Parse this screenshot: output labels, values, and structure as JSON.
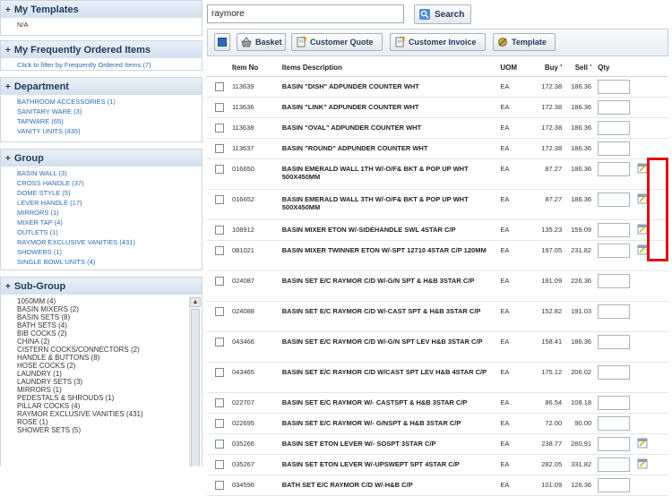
{
  "sidebar": {
    "templates": {
      "title": "My Templates",
      "value": "N/A"
    },
    "frequent": {
      "title": "My Frequently Ordered Items",
      "hint": "Click to filter by Frequently Ordered Items (7)"
    },
    "department": {
      "title": "Department",
      "items": [
        "BATHROOM ACCESSORIES (1)",
        "SANITARY WARE (3)",
        "TAPWARE (65)",
        "VANITY UNITS (435)"
      ]
    },
    "group": {
      "title": "Group",
      "items": [
        "BASIN WALL (3)",
        "CROSS HANDLE (37)",
        "DOME STYLE (5)",
        "LEVER HANDLE (17)",
        "MIRRORS (1)",
        "MIXER TAP (4)",
        "OUTLETS (1)",
        "RAYMOR EXCLUSIVE VANITIES (431)",
        "SHOWERS (1)",
        "SINGLE BOWL UNITS (4)"
      ]
    },
    "subgroup": {
      "title": "Sub-Group",
      "items": [
        "1050MM (4)",
        "BASIN MIXERS (2)",
        "BASIN SETS (8)",
        "BATH SETS (4)",
        "BIB COCKS (2)",
        "CHINA (2)",
        "CISTERN COCKS/CONNECTORS (2)",
        "HANDLE & BUTTONS (8)",
        "HOSE COCKS (2)",
        "LAUNDRY (1)",
        "LAUNDRY SETS (3)",
        "MIRRORS (1)",
        "PEDESTALS & SHROUDS (1)",
        "PILLAR COCKS (4)",
        "RAYMOR EXCLUSIVE VANITIES (431)",
        "ROSE (1)",
        "SHOWER SETS (5)"
      ]
    }
  },
  "search": {
    "value": "raymore",
    "button_label": "Search"
  },
  "toolbar": {
    "basket": "Basket",
    "customer_quote": "Customer Quote",
    "customer_invoice": "Customer Invoice",
    "template": "Template"
  },
  "table": {
    "headers": {
      "item_no": "Item No",
      "description": "Items Description",
      "uom": "UOM",
      "buy": "Buy",
      "sell": "Sell",
      "qty": "Qty"
    },
    "rows": [
      {
        "item": "113639",
        "desc": "BASIN \"DISH\" ADPUNDER COUNTER WHT",
        "uom": "EA",
        "buy": "172.38",
        "sell": "186.36",
        "note": false
      },
      {
        "item": "113636",
        "desc": "BASIN \"LINK\" ADPUNDER COUNTER WHT",
        "uom": "EA",
        "buy": "172.38",
        "sell": "186.36",
        "note": false
      },
      {
        "item": "113638",
        "desc": "BASIN \"OVAL\" ADPUNDER COUNTER WHT",
        "uom": "EA",
        "buy": "172.38",
        "sell": "186.36",
        "note": false
      },
      {
        "item": "113637",
        "desc": "BASIN \"ROUND\" ADPUNDER COUNTER WHT",
        "uom": "EA",
        "buy": "172.38",
        "sell": "186.36",
        "note": false
      },
      {
        "item": "016650",
        "desc": "BASIN EMERALD WALL 1TH W/-O/F& BKT & POP UP WHT 500X450MM",
        "uom": "EA",
        "buy": "87.27",
        "sell": "186.36",
        "note": true
      },
      {
        "item": "016652",
        "desc": "BASIN EMERALD WALL 3TH W/-O/F& BKT & POP UP WHT 500X450MM",
        "uom": "EA",
        "buy": "87.27",
        "sell": "186.36",
        "note": true
      },
      {
        "item": "108912",
        "desc": "BASIN MIXER ETON W/-SIDEHANDLE SWL 4STAR C/P",
        "uom": "EA",
        "buy": "135.23",
        "sell": "159.09",
        "note": true
      },
      {
        "item": "081021",
        "desc": "BASIN MIXER TWINNER ETON W/-SPT 12710 4STAR C/P 120MM",
        "uom": "EA",
        "buy": "197.05",
        "sell": "231.82",
        "note": true
      },
      {
        "item": "024087",
        "desc": "BASIN SET E/C RAYMOR C/D W/-G/N SPT & H&B 3STAR C/P",
        "uom": "EA",
        "buy": "181.09",
        "sell": "226.36",
        "note": false
      },
      {
        "item": "024088",
        "desc": "BASIN SET E/C RAYMOR C/D W/-CAST SPT & H&B 3STAR C/P",
        "uom": "EA",
        "buy": "152.82",
        "sell": "191.03",
        "note": false
      },
      {
        "item": "043466",
        "desc": "BASIN SET E/C RAYMOR C/D W/-G/N SPT LEV H&B 3STAR C/P",
        "uom": "EA",
        "buy": "158.41",
        "sell": "186.36",
        "note": false
      },
      {
        "item": "043465",
        "desc": "BASIN SET E/C RAYMOR C/D W/CAST SPT LEV H&B 4STAR C/P",
        "uom": "EA",
        "buy": "175.12",
        "sell": "206.02",
        "note": false
      },
      {
        "item": "022707",
        "desc": "BASIN SET E/C RAYMOR W/- CASTSPT & H&B 3STAR C/P",
        "uom": "EA",
        "buy": "86.54",
        "sell": "108.18",
        "note": false
      },
      {
        "item": "022695",
        "desc": "BASIN SET E/C RAYMOR W/- G/NSPT & H&B 3STAR C/P",
        "uom": "EA",
        "buy": "72.00",
        "sell": "90.00",
        "note": false
      },
      {
        "item": "035266",
        "desc": "BASIN SET ETON LEVER W/- SOSPT 3STAR C/P",
        "uom": "EA",
        "buy": "238.77",
        "sell": "280.91",
        "note": true
      },
      {
        "item": "035267",
        "desc": "BASIN SET ETON LEVER W/-UPSWEPT SPT 4STAR C/P",
        "uom": "EA",
        "buy": "282.05",
        "sell": "331.82",
        "note": true
      },
      {
        "item": "034596",
        "desc": "BATH SET E/C RAYMOR C/D W/-H&B C/P",
        "uom": "EA",
        "buy": "101.09",
        "sell": "126.36",
        "note": false
      }
    ]
  },
  "colors": {
    "accent": "#2b6bb5",
    "header_bg": "#d3e1ee",
    "highlight": "#e01010"
  }
}
